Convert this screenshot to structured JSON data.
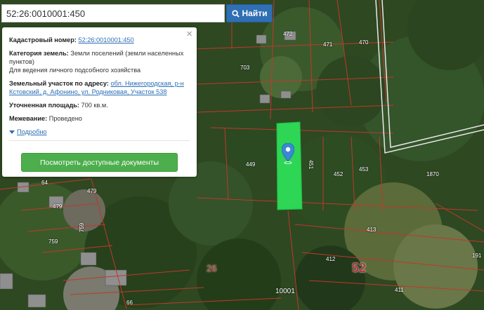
{
  "search": {
    "value": "52:26:0010001:450",
    "button_label": "Найти"
  },
  "popup": {
    "cadastral_label": "Кадастровый номер:",
    "cadastral_value": "52:26:0010001:450",
    "category_label": "Категория земель:",
    "category_value": "Земли поселений (земли населенных пунктов)",
    "use_value": "Для ведения личного подсобного хозяйства",
    "address_label": "Земельный участок по адресу:",
    "address_value": "обл. Нижегородская, р-н Кстовский, д. Афонино, ул. Родниковая, Участок 538",
    "area_label": "Уточненная площадь:",
    "area_value": "700 кв.м.",
    "survey_label": "Межевание:",
    "survey_value": "Проведено",
    "details_link": "Подробно",
    "documents_button": "Посмотреть доступные документы",
    "close_glyph": "×"
  },
  "map": {
    "parcel_labels": [
      "472",
      "471",
      "470",
      "703",
      "449",
      "451",
      "452",
      "453",
      "1870",
      "64",
      "479",
      "479",
      "759",
      "759",
      "413",
      "412",
      "411",
      "66",
      "191"
    ],
    "quarter_label": "52",
    "sub_label": "26",
    "block_label": "10001",
    "colors": {
      "boundary": "#c0392b",
      "selected_parcel": "#2ee65a",
      "marker": "#3b87d6"
    }
  }
}
